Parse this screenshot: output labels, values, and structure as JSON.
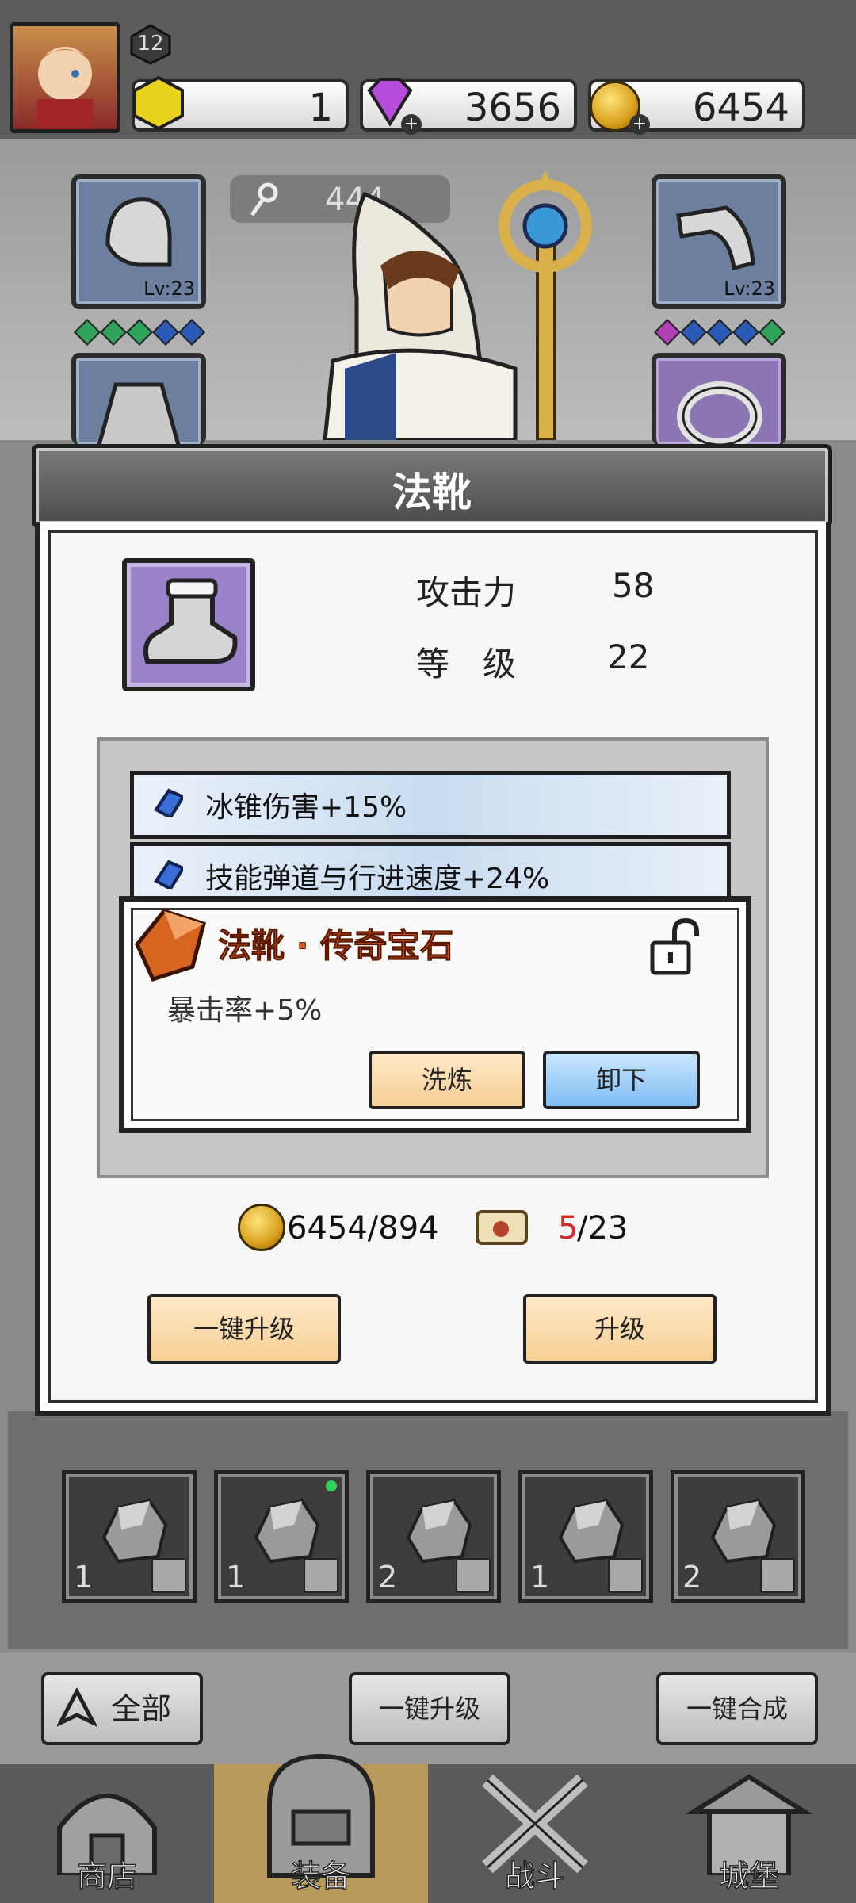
{
  "header": {
    "level": "12",
    "resources": [
      {
        "name": "energy",
        "value": "1"
      },
      {
        "name": "gems",
        "value": "3656"
      },
      {
        "name": "gold",
        "value": "6454"
      }
    ]
  },
  "stage": {
    "key_count": "444",
    "slots": [
      {
        "name": "helmet",
        "level": "Lv:23"
      },
      {
        "name": "bracer",
        "level": "Lv:23"
      }
    ]
  },
  "dialog": {
    "title": "法靴",
    "stats": [
      {
        "label": "攻击力",
        "value": "58"
      },
      {
        "label": "等　级",
        "value": "22"
      }
    ],
    "affixes": [
      {
        "text": "冰锥伤害+15%"
      },
      {
        "text": "技能弹道与行进速度+24%"
      }
    ],
    "gem": {
      "title": "法靴 · 传奇宝石",
      "effect": "暴击率+5%",
      "refine_label": "洗炼",
      "remove_label": "卸下"
    },
    "cost": {
      "gold": "6454/894",
      "scroll_have": "5",
      "scroll_need": "/23"
    },
    "upgrade_all_label": "一键升级",
    "upgrade_label": "升级"
  },
  "inventory": {
    "items": [
      {
        "count": "1"
      },
      {
        "count": "1"
      },
      {
        "count": "2"
      },
      {
        "count": "1"
      },
      {
        "count": "2"
      }
    ]
  },
  "actions": {
    "filter_label": "全部",
    "upgrade_all_label": "一键升级",
    "merge_all_label": "一键合成"
  },
  "tabs": [
    {
      "label": "商店"
    },
    {
      "label": "装备"
    },
    {
      "label": "战斗"
    },
    {
      "label": "城堡"
    }
  ],
  "colors": {
    "gem_title": "#e2551c",
    "scroll_have": "#d42a2a",
    "active_tab": "#b89a5a"
  }
}
